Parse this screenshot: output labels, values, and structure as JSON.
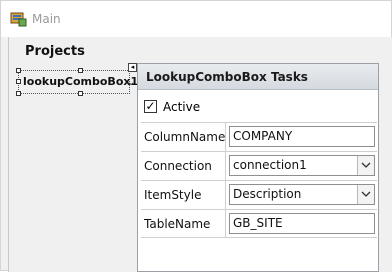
{
  "window": {
    "title": "Main"
  },
  "form": {
    "section_title": "Projects"
  },
  "combo": {
    "name": "lookupComboBox1",
    "arrow_glyph": "⌄"
  },
  "smart_tag": {
    "glyph": "◂"
  },
  "tasks": {
    "title": "LookupComboBox Tasks",
    "active": {
      "label": "Active",
      "checked": true,
      "mark": "✓"
    },
    "rows": [
      {
        "label": "ColumnName",
        "value": "COMPANY",
        "type": "text"
      },
      {
        "label": "Connection",
        "value": "connection1",
        "type": "dropdown"
      },
      {
        "label": "ItemStyle",
        "value": "Description",
        "type": "dropdown"
      },
      {
        "label": "TableName",
        "value": "GB_SITE",
        "type": "text"
      }
    ]
  },
  "colors": {
    "panel_header_top": "#e9ecef",
    "panel_header_bottom": "#d5dae0",
    "form_bg": "#f0f0f0"
  }
}
